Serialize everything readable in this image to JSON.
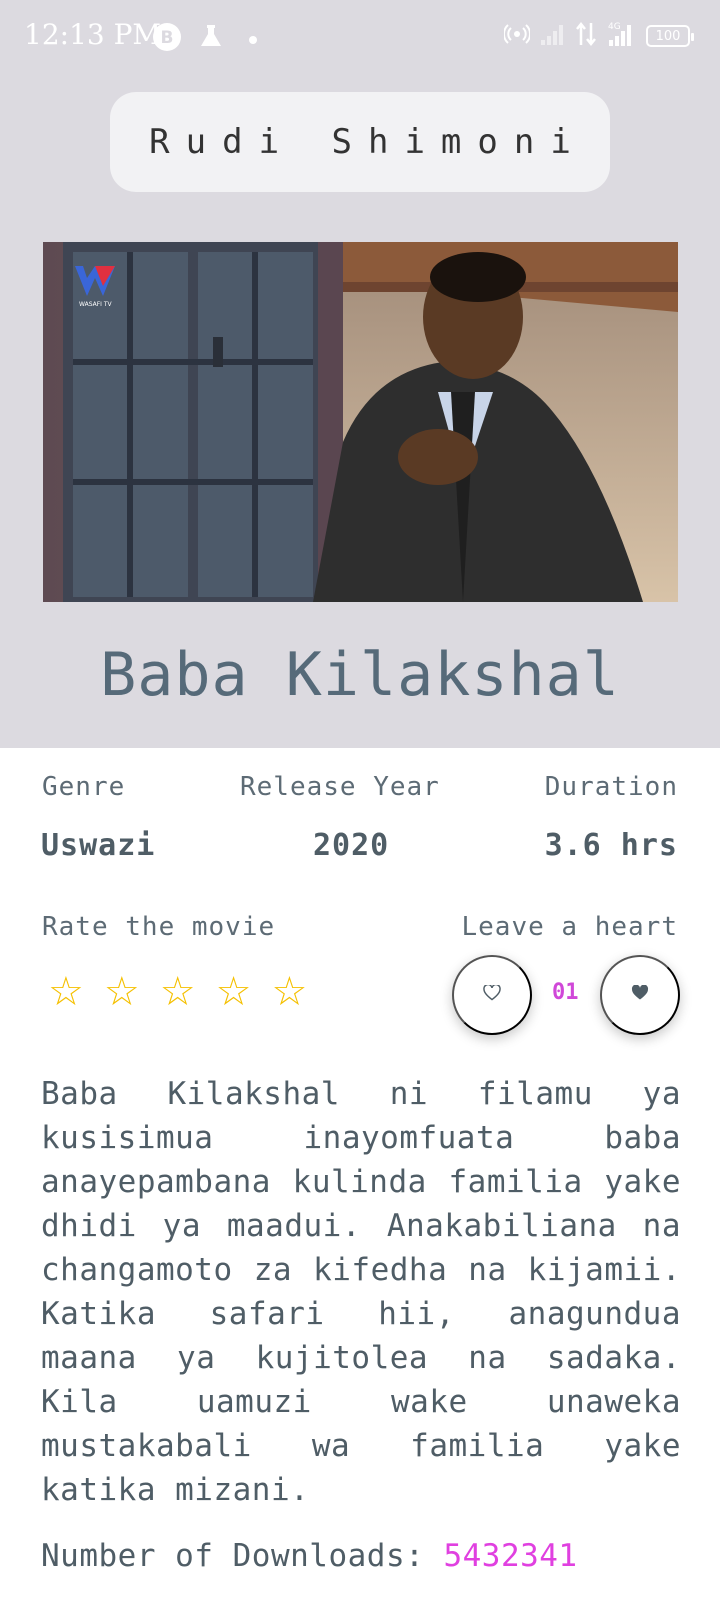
{
  "status_bar": {
    "time": "12:13 PM",
    "battery": "100",
    "network": "4G"
  },
  "back_button": {
    "label": "Rudi Shimoni"
  },
  "movie": {
    "title": "Baba Kilakshal",
    "poster_logo_text": "WASAFI TV"
  },
  "meta": {
    "genre_label": "Genre",
    "genre_value": "Uswazi",
    "year_label": "Release Year",
    "year_value": "2020",
    "duration_label": "Duration",
    "duration_value": "3.6 hrs"
  },
  "rating": {
    "label": "Rate the movie",
    "stars": 5,
    "selected": 0
  },
  "heart": {
    "label": "Leave a heart",
    "count": "01"
  },
  "description": "Baba Kilakshal ni filamu ya kusisimua inayomfuata baba anayepambana kulinda familia yake dhidi ya maadui. Anakabiliana na changamoto za kifedha na kijamii. Katika safari hii, anagundua maana ya kujitolea na sadaka. Kila uamuzi wake unaweka mustakabali wa familia yake katika mizani.",
  "downloads": {
    "label": "Number of Downloads:",
    "value": "5432341"
  },
  "colors": {
    "header_bg": "#dcdae0",
    "title": "#566a79",
    "star": "#f5c000",
    "accent": "#e040e0"
  }
}
